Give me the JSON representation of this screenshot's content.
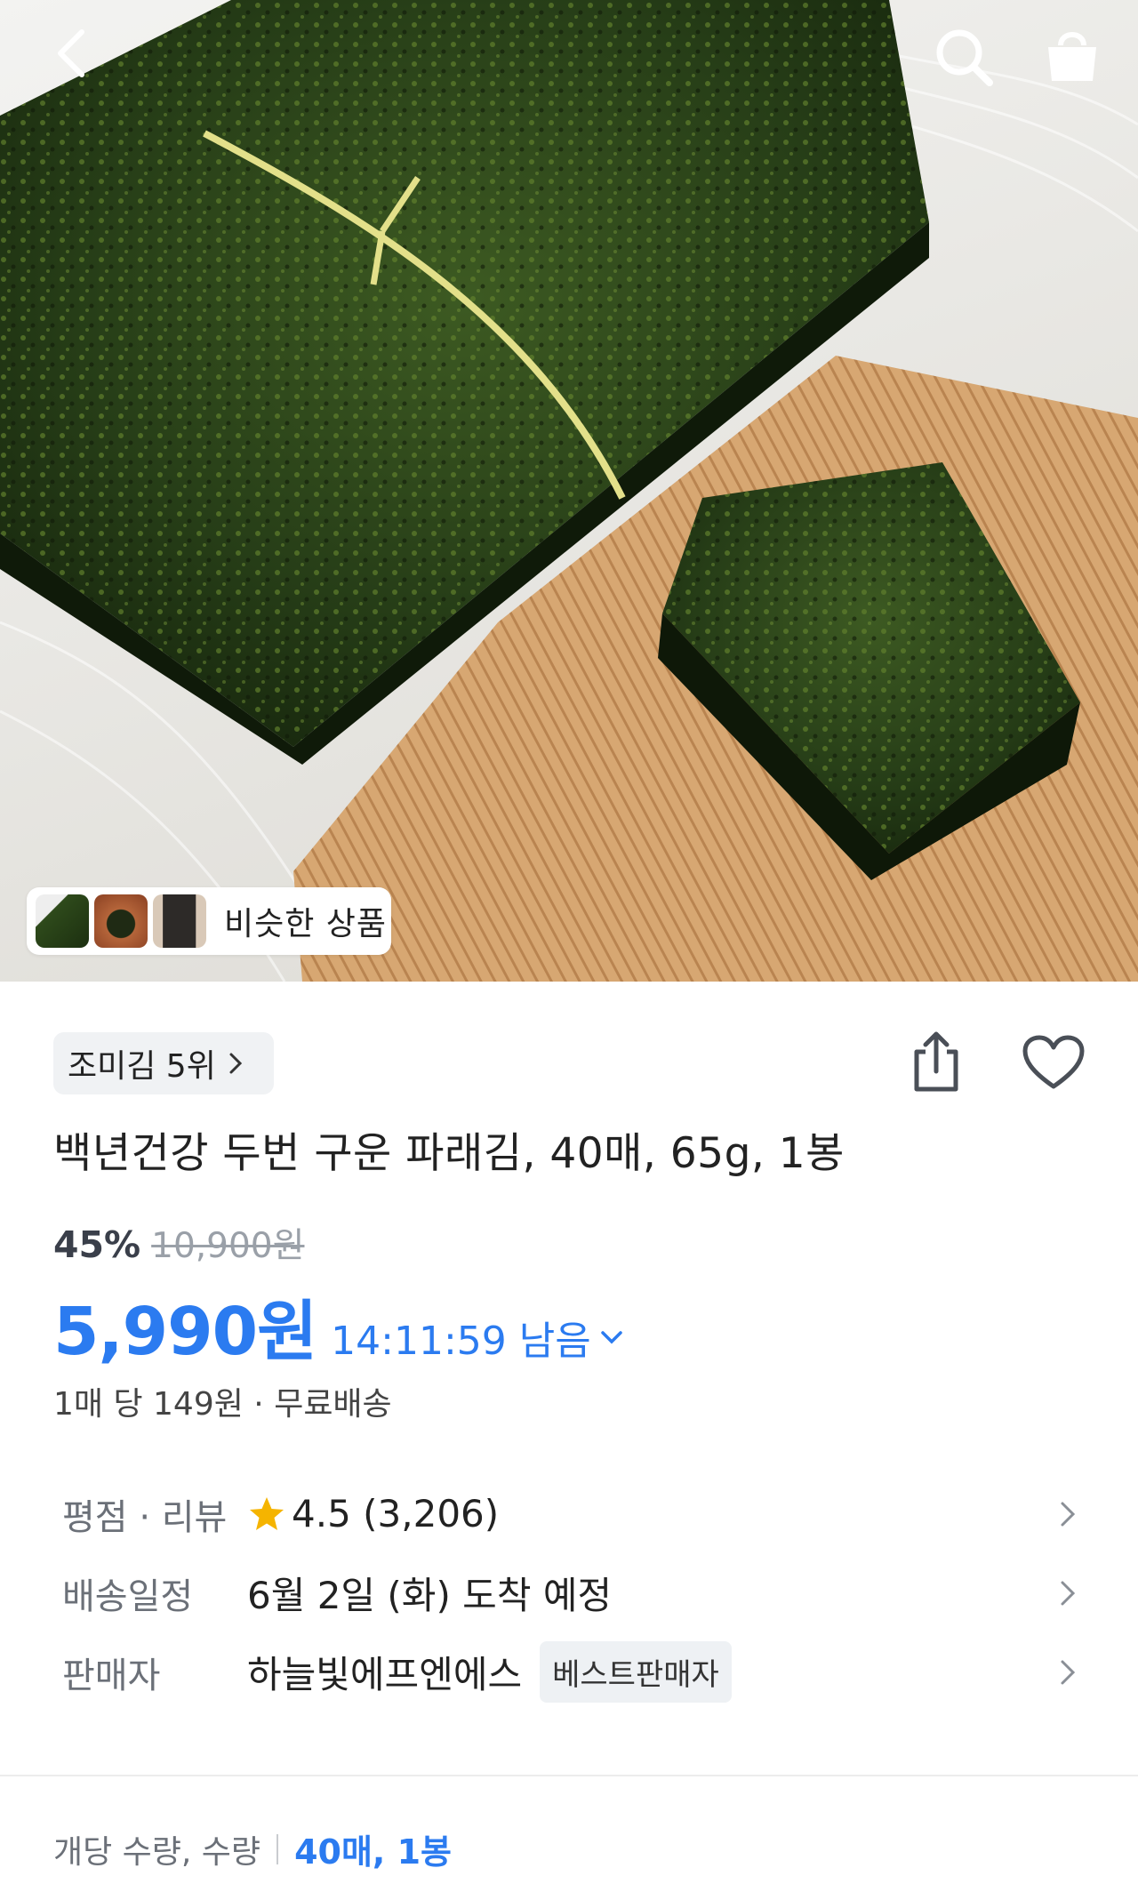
{
  "header": {
    "back_icon": "chevron-left-icon",
    "search_icon": "search-icon",
    "cart_icon": "shopping-bag-icon"
  },
  "hero": {
    "similar_label": "비슷한 상품"
  },
  "product": {
    "rank_label": "조미김 5위",
    "title": "백년건강 두번 구운 파래김, 40매, 65g, 1봉",
    "discount_rate": "45%",
    "original_price": "10,900원",
    "sale_price": "5,990원",
    "timer": "14:11:59 남음",
    "unit_info": "1매 당 149원 · 무료배송"
  },
  "info": {
    "rating_key": "평점 · 리뷰",
    "rating_value": "4.5 (3,206)",
    "delivery_key": "배송일정",
    "delivery_value": "6월 2일 (화) 도착 예정",
    "seller_key": "판매자",
    "seller_value": "하늘빛에프엔에스",
    "seller_badge": "베스트판매자"
  },
  "option": {
    "label": "개당 수량, 수량",
    "value": "40매, 1봉"
  },
  "colors": {
    "accent": "#2b7bf0",
    "star": "#f5b400"
  }
}
